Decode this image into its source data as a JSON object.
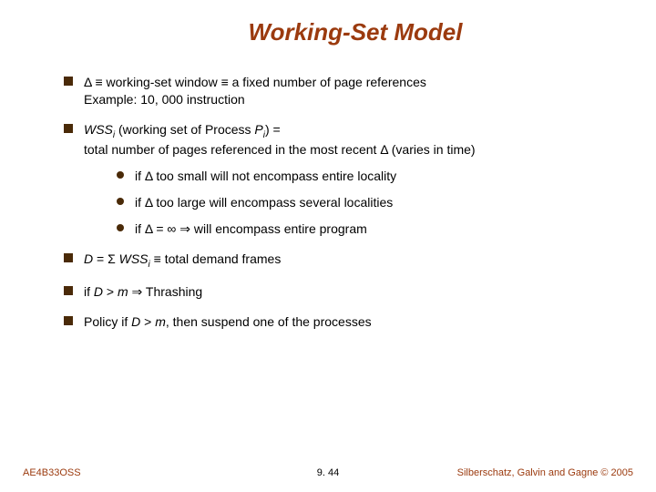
{
  "title": "Working-Set Model",
  "bullets": {
    "b1a": "Δ ≡ working-set window ≡ a fixed number of page references",
    "b1b": "Example:  10, 000 instruction",
    "b2a_prefix": "WSS",
    "b2a_sub": "i",
    "b2a_mid": " (working set of Process ",
    "b2a_p": "P",
    "b2a_psub": "i",
    "b2a_suffix": ") =",
    "b2b": "total number of pages referenced in the most recent Δ (varies in time)",
    "s1": "if Δ too small will not encompass entire locality",
    "s2": "if Δ too large will encompass several localities",
    "s3": "if Δ = ∞ ⇒ will encompass entire program",
    "b3_d": "D",
    "b3_eq": " = Σ ",
    "b3_w": "WSS",
    "b3_wsub": "i",
    "b3_def": " ≡ total demand frames",
    "b4_pre": "if ",
    "b4_d": "D",
    "b4_gt": " > ",
    "b4_m": "m",
    "b4_thr": " ⇒ Thrashing",
    "b5_pre": "Policy if ",
    "b5_d": "D",
    "b5_gt": " > ",
    "b5_m": "m",
    "b5_tail": ", then suspend one of the processes"
  },
  "footer": {
    "left": "AE4B33OSS",
    "center": "9. 44",
    "right": "Silberschatz, Galvin and Gagne © 2005"
  }
}
